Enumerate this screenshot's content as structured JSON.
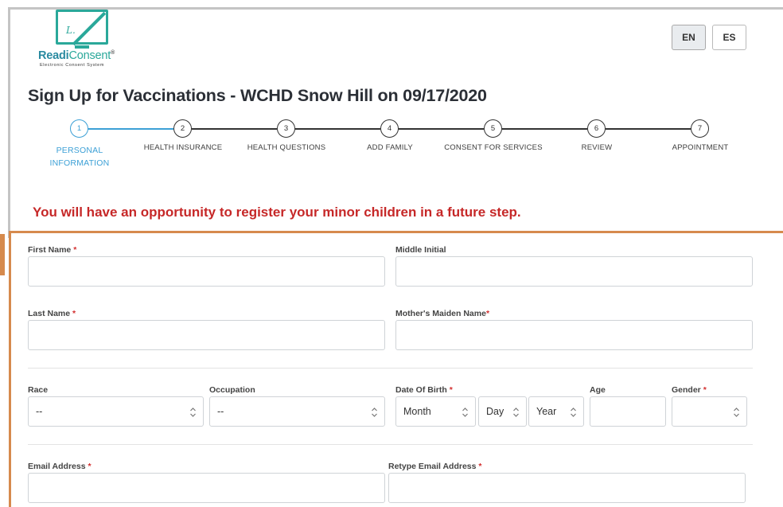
{
  "logo": {
    "name_bold": "Readi",
    "name_light": "Consent",
    "registered": "®",
    "tagline": "Electronic Consent System",
    "scribble": "L."
  },
  "language": {
    "en": "EN",
    "es": "ES"
  },
  "page_title": "Sign Up for Vaccinations - WCHD Snow Hill on 09/17/2020",
  "steps": [
    {
      "number": "1",
      "label": "PERSONAL INFORMATION",
      "active": true
    },
    {
      "number": "2",
      "label": "HEALTH INSURANCE"
    },
    {
      "number": "3",
      "label": "HEALTH QUESTIONS"
    },
    {
      "number": "4",
      "label": "ADD FAMILY"
    },
    {
      "number": "5",
      "label": "CONSENT FOR SERVICES"
    },
    {
      "number": "6",
      "label": "REVIEW"
    },
    {
      "number": "7",
      "label": "APPOINTMENT"
    }
  ],
  "notice": "You will have an opportunity to register your minor children in a future step.",
  "form": {
    "first_name": {
      "label": "First Name",
      "req": "*",
      "value": ""
    },
    "middle_initial": {
      "label": "Middle Initial",
      "value": ""
    },
    "last_name": {
      "label": "Last Name",
      "req": "*",
      "value": ""
    },
    "maiden_name": {
      "label": "Mother's Maiden Name",
      "req": "*",
      "value": ""
    },
    "race": {
      "label": "Race",
      "value": "--"
    },
    "occupation": {
      "label": "Occupation",
      "value": "--"
    },
    "dob": {
      "label": "Date Of Birth",
      "req": "*",
      "month": "Month",
      "day": "Day",
      "year": "Year"
    },
    "age": {
      "label": "Age",
      "value": ""
    },
    "gender": {
      "label": "Gender",
      "req": "*",
      "value": ""
    },
    "email": {
      "label": "Email Address",
      "req": "*",
      "value": ""
    },
    "retype_email": {
      "label": "Retype Email Address",
      "req": "*",
      "value": ""
    }
  },
  "colors": {
    "accent": "#3ca0d6",
    "notice": "#c62828",
    "frame_orange": "#d68a4d",
    "logo_teal": "#2aa89a"
  }
}
